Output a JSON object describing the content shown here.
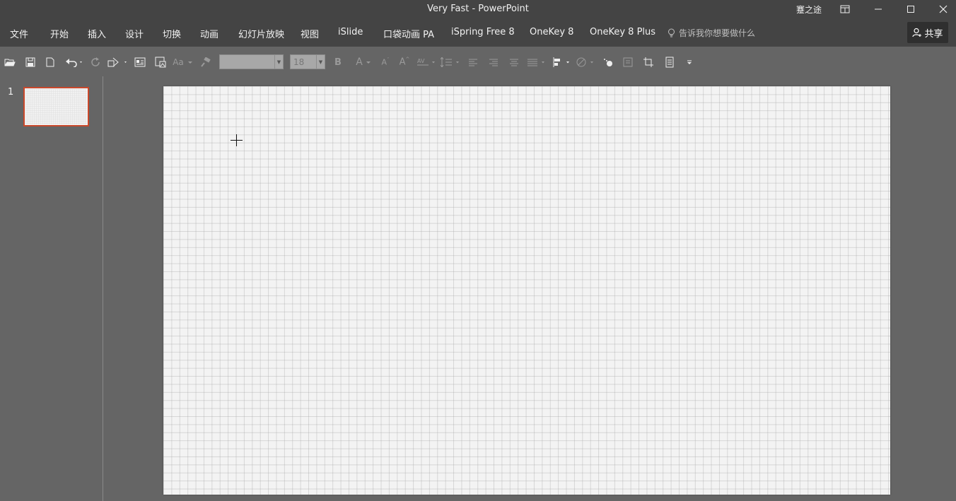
{
  "window": {
    "title": "Very Fast  -  PowerPoint",
    "user": "蹇之途"
  },
  "menu": {
    "tabs": [
      "文件",
      "开始",
      "插入",
      "设计",
      "切换",
      "动画",
      "幻灯片放映",
      "视图",
      "iSlide",
      "口袋动画 PA",
      "iSpring Free 8",
      "OneKey 8",
      "OneKey 8 Plus"
    ],
    "tell_me": "告诉我你想要做什么",
    "share": "共享"
  },
  "toolbar": {
    "font_name": "",
    "font_size": "18",
    "bold_label": "B",
    "case_label": "Aa"
  },
  "thumbnails": {
    "slides": [
      {
        "number": "1"
      }
    ]
  },
  "colors": {
    "accent_selection": "#c9482b",
    "background": "#656565",
    "titlebar": "#444444"
  }
}
